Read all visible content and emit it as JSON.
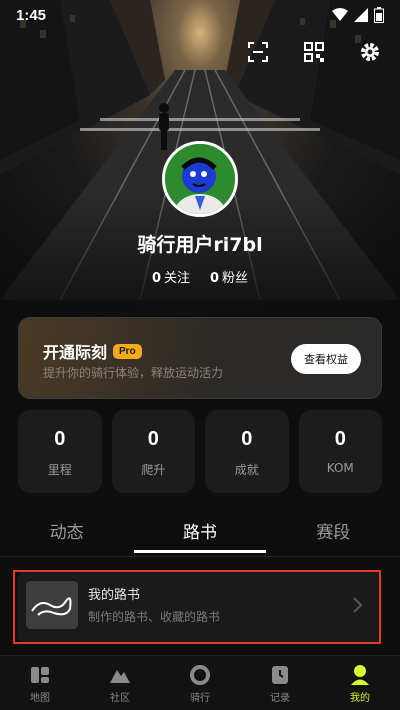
{
  "status_bar": {
    "time": "1:45"
  },
  "profile": {
    "username": "骑行用户ri7bl",
    "following_count": "0",
    "following_label": "关注",
    "followers_count": "0",
    "followers_label": "粉丝"
  },
  "pro_card": {
    "title": "开通际刻",
    "badge": "Pro",
    "subtitle": "提升你的骑行体验，释放运动活力",
    "button_label": "查看权益"
  },
  "stats": [
    {
      "value": "0",
      "label": "里程"
    },
    {
      "value": "0",
      "label": "爬升"
    },
    {
      "value": "0",
      "label": "成就"
    },
    {
      "value": "0",
      "label": "KOM"
    }
  ],
  "tabs": [
    {
      "label": "动态",
      "active": false
    },
    {
      "label": "路书",
      "active": true
    },
    {
      "label": "赛段",
      "active": false
    }
  ],
  "route_card": {
    "title": "我的路书",
    "subtitle": "制作的路书、收藏的路书"
  },
  "bottom_nav": [
    {
      "label": "地图",
      "icon": "map-icon",
      "active": false
    },
    {
      "label": "社区",
      "icon": "community-icon",
      "active": false
    },
    {
      "label": "骑行",
      "icon": "ride-icon",
      "active": false
    },
    {
      "label": "记录",
      "icon": "record-icon",
      "active": false
    },
    {
      "label": "我的",
      "icon": "profile-icon",
      "active": true
    }
  ],
  "colors": {
    "accent": "#d8f536",
    "pro_badge": "#f5a91e",
    "highlight_outline": "#e53935"
  }
}
